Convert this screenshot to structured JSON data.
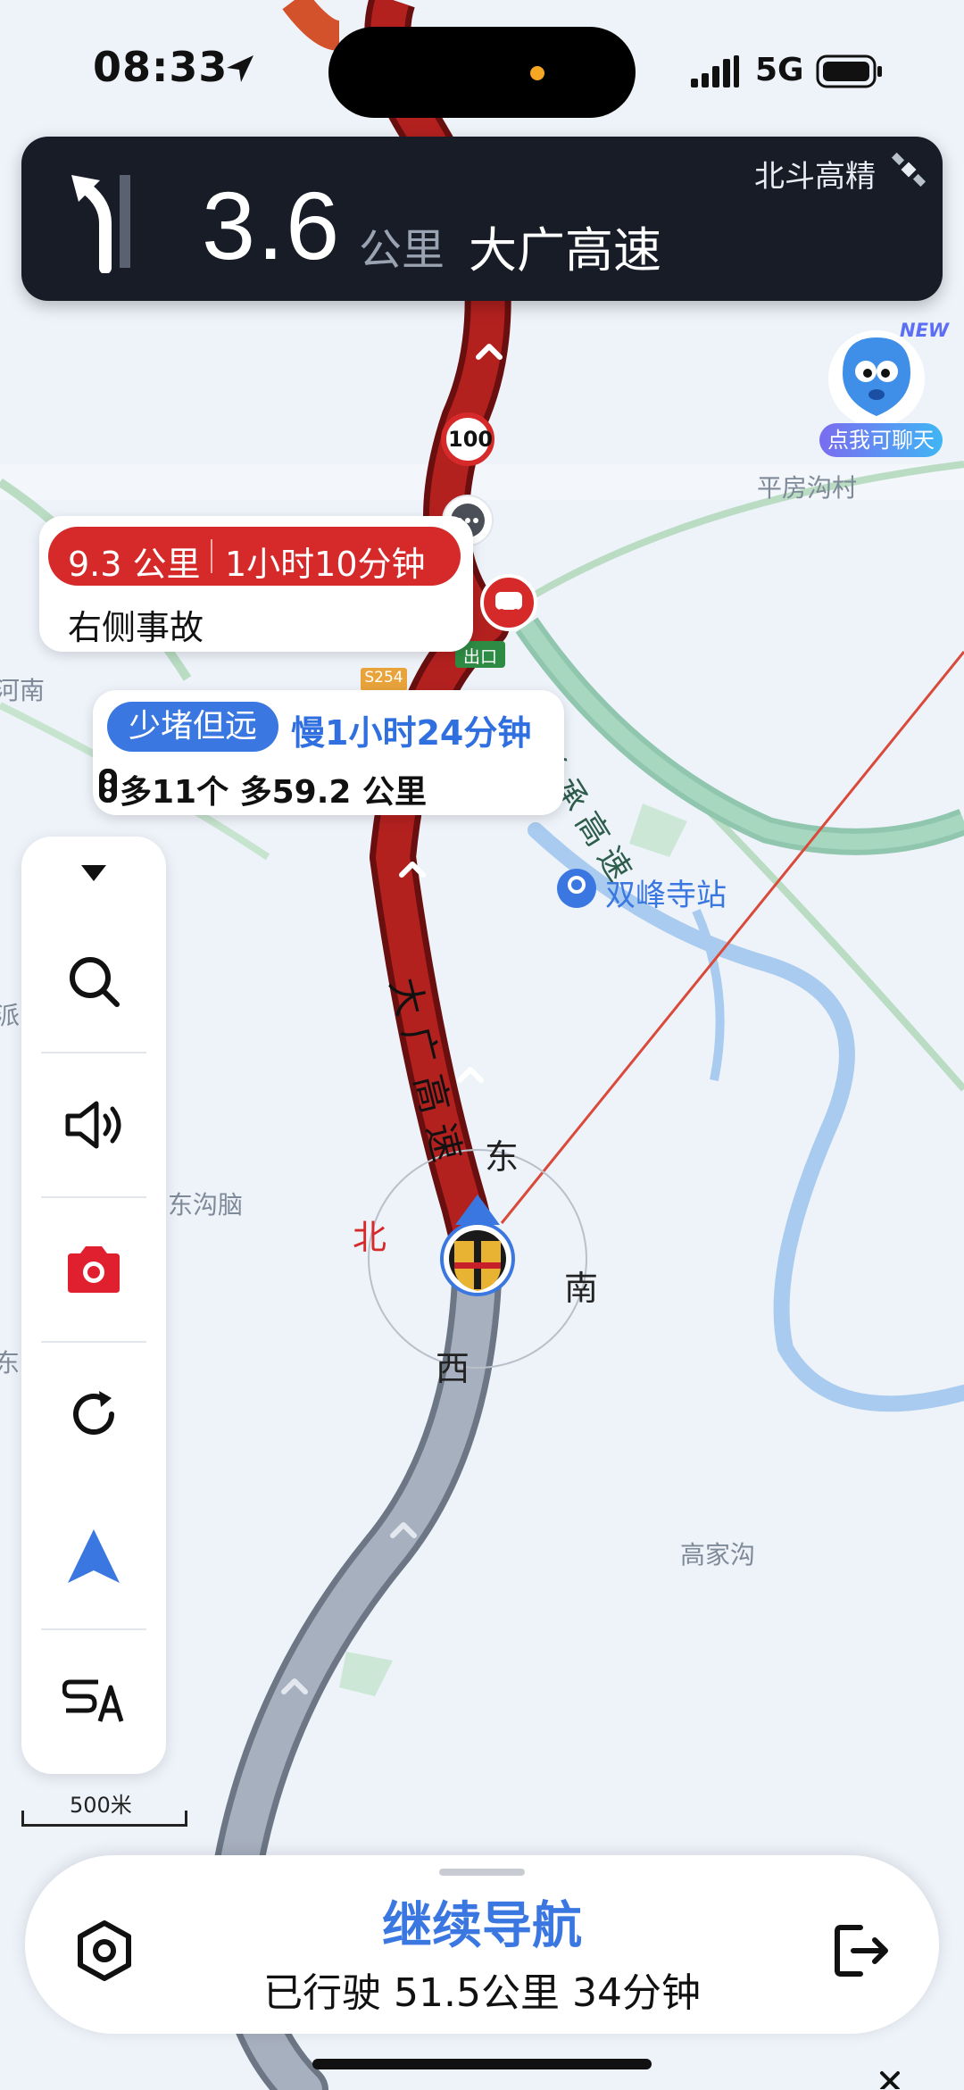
{
  "status_bar": {
    "time": "08:33",
    "network": "5G"
  },
  "nav_banner": {
    "distance": "3.6",
    "unit": "公里",
    "road": "大广高速",
    "positioning": "北斗高精"
  },
  "assistant": {
    "badge": "NEW",
    "label": "点我可聊天"
  },
  "incident": {
    "distance": "9.3 公里",
    "duration": "1小时10分钟",
    "description": "右侧事故"
  },
  "alternative_route": {
    "badge": "少堵但远",
    "slower": "慢1小时24分钟",
    "extra": "多11个 多59.2 公里"
  },
  "route_markers": {
    "speed_limit": "100",
    "exit_sign": "出口",
    "road_code": "S254"
  },
  "map_labels": {
    "pingfanggoucun": "平房沟村",
    "henan": "河南",
    "shuangfengsi": "双峰寺站",
    "changchengroad": "长承高速",
    "dagao": "大广高速",
    "donggounao": "东沟脑",
    "gaojiagou": "高家沟",
    "edge_left_1": "河南",
    "edge_left_2": "派",
    "edge_left_3": "东"
  },
  "compass": {
    "north": "北",
    "east": "东",
    "south": "南",
    "west": "西"
  },
  "toolbar": {
    "items": [
      "collapse",
      "search",
      "voice",
      "camera",
      "refresh",
      "locate",
      "layers"
    ]
  },
  "scale": {
    "label": "500米"
  },
  "bottom_panel": {
    "continue_label": "继续导航",
    "trip_summary": "已行驶 51.5公里 34分钟"
  },
  "colors": {
    "accent": "#3a77e0",
    "congestion": "#b3211f",
    "incident": "#d62a2a",
    "banner": "#171c26"
  }
}
